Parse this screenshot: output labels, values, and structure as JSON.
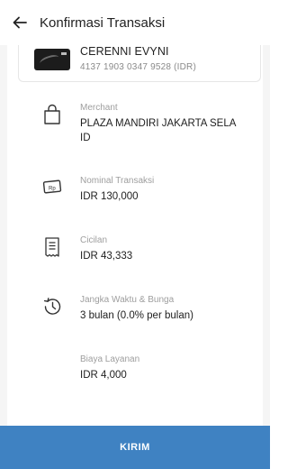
{
  "header": {
    "title": "Konfirmasi Transaksi",
    "back_icon": "arrow-left-icon"
  },
  "card": {
    "holder_name": "CERENNI EVYNI",
    "account_number": "4137 1903 0347 9528 (IDR)"
  },
  "details": [
    {
      "icon": "shopping-bag-icon",
      "label": "Merchant",
      "value": "PLAZA MANDIRI JAKARTA SELA ID"
    },
    {
      "icon": "cash-note-icon",
      "label": "Nominal Transaksi",
      "value": "IDR 130,000"
    },
    {
      "icon": "receipt-icon",
      "label": "Cicilan",
      "value": "IDR 43,333"
    },
    {
      "icon": "history-clock-icon",
      "label": "Jangka Waktu & Bunga",
      "value": "3 bulan (0.0% per bulan)"
    },
    {
      "icon": "",
      "label": "Biaya Layanan",
      "value": "IDR 4,000"
    }
  ],
  "submit": {
    "label": "KIRIM"
  },
  "colors": {
    "primary": "#3f82c2",
    "background": "#f5f5f5",
    "muted_text": "#9e9e9e"
  }
}
